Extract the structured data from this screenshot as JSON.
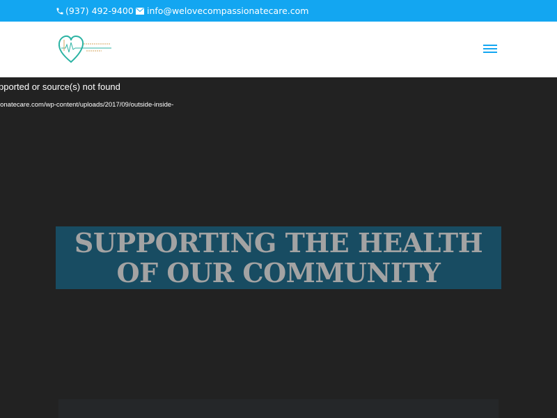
{
  "topbar": {
    "background": "#13a6f1",
    "phone": "(937) 492-9400",
    "email": "info@welovecompassionatecare.com",
    "phone_icon": "phone-icon",
    "email_icon": "mail-icon"
  },
  "header": {
    "logo_icon": "heart-logo-icon",
    "menu_icon": "hamburger-menu-icon"
  },
  "hero": {
    "media_error": "pported or source(s) not found",
    "media_url": "ionatecare.com/wp-content/uploads/2017/09/outside-inside-",
    "headline_line1": "SUPPORTING THE HEALTH",
    "headline_line2": "OF OUR COMMUNITY",
    "headline_bg": "#184c62"
  }
}
